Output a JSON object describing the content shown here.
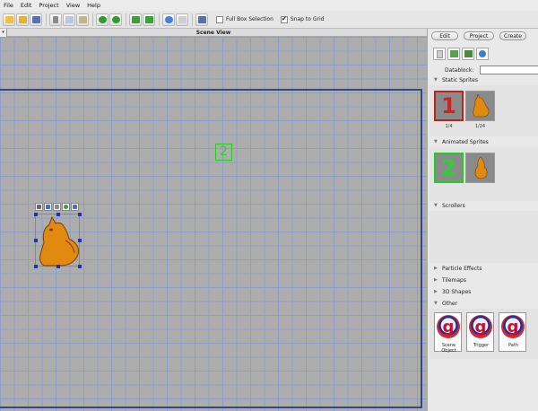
{
  "menu": [
    "File",
    "Edit",
    "Project",
    "View",
    "Help"
  ],
  "toolbar": {
    "full_box_selection": "Full Box Selection",
    "snap_to_grid": "Snap to Grid",
    "snap_checked": "✔"
  },
  "scene": {
    "title": "Scene View",
    "scroll_arrow": "▾",
    "sprite2_label": "2"
  },
  "panel": {
    "tabs": [
      "Edit",
      "Project",
      "Create"
    ],
    "datablock_label": "Datablock:",
    "sections": {
      "static": "Static Sprites",
      "animated": "Animated Sprites",
      "scrollers": "Scrollers",
      "particles": "Particle Effects",
      "tilemaps": "Tilemaps",
      "shapes": "3D Shapes",
      "other": "Other"
    },
    "static_items": [
      {
        "num": "1",
        "label": "1/4"
      },
      {
        "num": "",
        "label": "1/24"
      }
    ],
    "animated_items": [
      {
        "num": "2"
      },
      {
        "num": ""
      }
    ],
    "other_items": [
      {
        "glyph": "g",
        "label": "Scene Object"
      },
      {
        "glyph": "g",
        "label": "Trigger"
      },
      {
        "glyph": "g",
        "label": "Path"
      }
    ]
  },
  "colors": {
    "grid": "#adadad",
    "grid_lines": "#8f9ec8",
    "bounds": "#2c4a8c",
    "sprite_one": "#d62020",
    "sprite_two": "#33cc33",
    "creature": "#e08a10"
  }
}
